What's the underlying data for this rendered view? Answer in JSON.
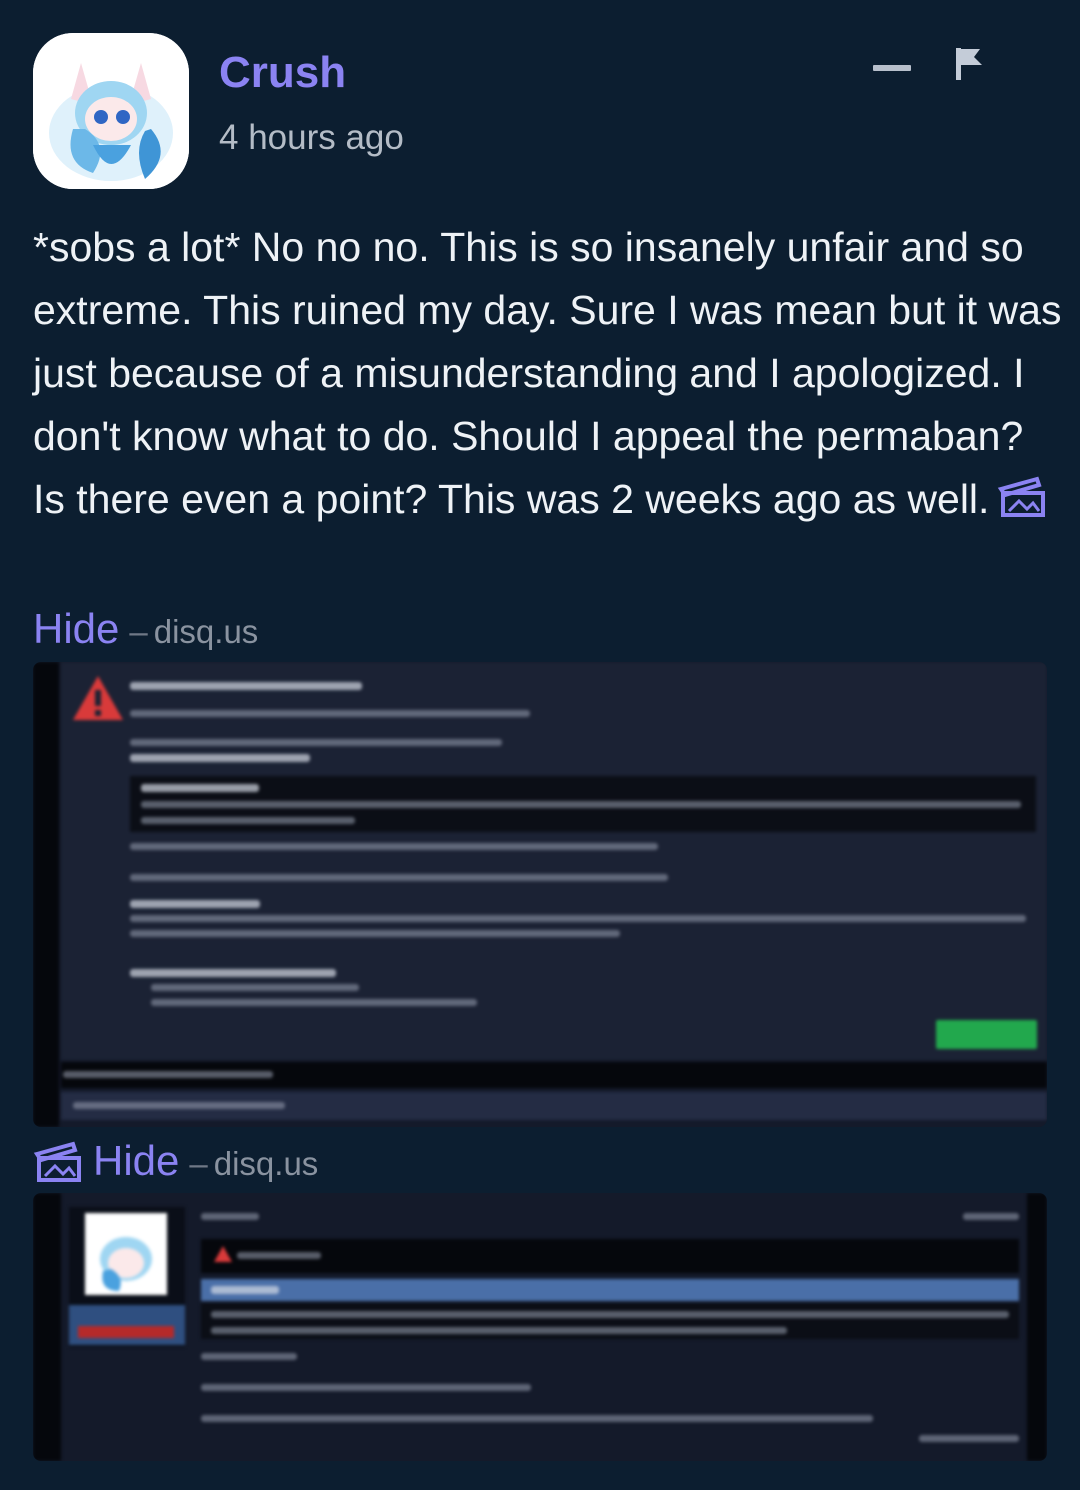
{
  "post": {
    "username": "Crush",
    "timestamp": "4 hours ago",
    "body": "*sobs a lot* No no no. This is so insanely unfair and so extreme. This ruined my day. Sure I was mean but it was just because of a misunderstanding and I apologized. I don't know what to do. Should I appeal the permaban? Is there even a point? This was 2 weeks ago as well."
  },
  "embeds": [
    {
      "hide_label": "Hide",
      "separator": "–",
      "source": "disq.us",
      "icon": "image-icon"
    },
    {
      "hide_label": "Hide",
      "separator": "–",
      "source": "disq.us",
      "icon": "image-icon"
    }
  ],
  "icons": {
    "collapse": "minus-icon",
    "report": "flag-icon",
    "avatar": "avatar-image"
  },
  "colors": {
    "background": "#0c1e30",
    "username": "#8b83f2",
    "link": "#8b83f2",
    "text": "#eef2f6",
    "muted": "#8a93a0",
    "warning": "#d93a3a",
    "understand_button": "#22a84d"
  }
}
